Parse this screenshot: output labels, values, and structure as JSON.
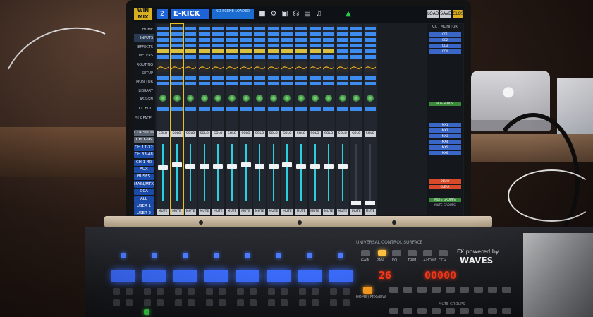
{
  "app": {
    "logo_line1": "WIN",
    "logo_line2": "MIX",
    "channel_number": "2",
    "channel_name": "E-KICK",
    "scene_label": "NO SCENE LOADED",
    "top_buttons": {
      "load": "LOAD",
      "save": "SAVE",
      "close": "CLOSE"
    }
  },
  "nav": {
    "items": [
      {
        "label": "HOME",
        "active": false
      },
      {
        "label": "INPUTS",
        "active": true
      },
      {
        "label": "EFFECTS",
        "active": false
      },
      {
        "label": "METERS",
        "active": false
      },
      {
        "label": "ROUTING",
        "active": false
      },
      {
        "label": "SETUP",
        "active": false
      },
      {
        "label": "MONITOR",
        "active": false
      },
      {
        "label": "LIBRARY",
        "active": false
      },
      {
        "label": "ASSIGN",
        "active": false
      },
      {
        "label": "CC EDIT",
        "active": false
      }
    ],
    "surface_label": "SURFACE",
    "groups": [
      "CLR SOLO",
      "CH 1-16",
      "CH 17-32",
      "CH 33-48",
      "CH 1-40",
      "AUX",
      "BUSES",
      "MAIN/MTX",
      "DCA",
      "ALL",
      "USER 1",
      "USER 2"
    ]
  },
  "strips": {
    "solo_label": "SOLO",
    "mute_label": "MUTE",
    "count": 16,
    "selected_index": 1
  },
  "monitor": {
    "title": "CC / MONITOR",
    "buttons": [
      "CC1",
      "CC2",
      "CC3",
      "CC4",
      "BUS SENDS",
      "MX1",
      "MX2",
      "MX3",
      "MX4",
      "MX5",
      "MX6",
      "DELAY",
      "CLEAR",
      "MUTE GROUPS"
    ],
    "mute_groups_label": "MUTE GROUPS"
  },
  "console": {
    "title": "UNIVERSAL CONTROL SURFACE",
    "fx_label": "FX powered by",
    "brand": "WAVES",
    "channel_display": "26",
    "scene_display": "00000",
    "labels": [
      "GAIN",
      "PAN",
      "EQ",
      "TRIM",
      "+HOME",
      "CC+"
    ],
    "home_label": "HOME / MIXVIEW",
    "mute_groups_label": "MUTE-GROUPS"
  }
}
